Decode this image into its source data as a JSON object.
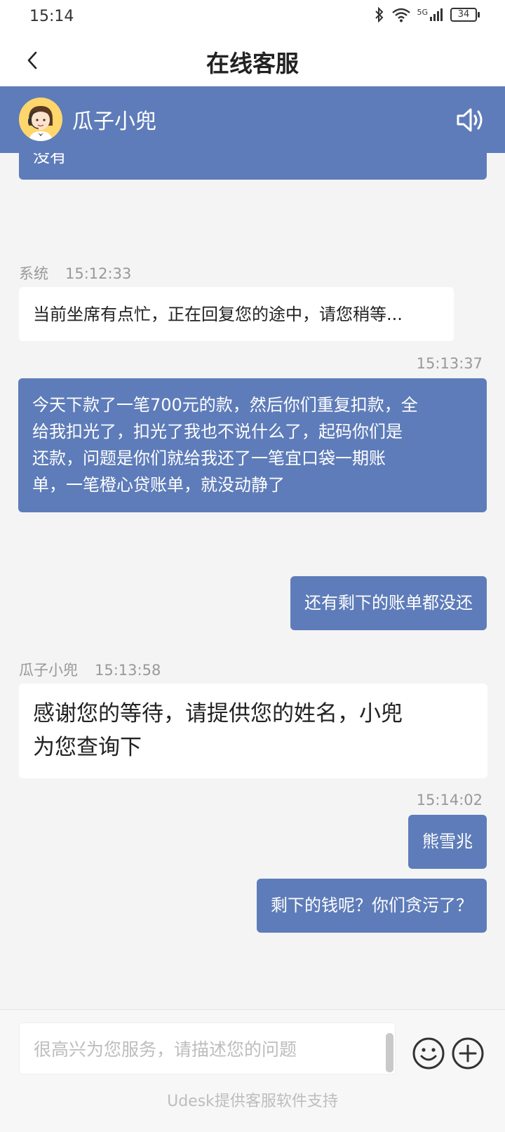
{
  "status_bar": {
    "time": "15:14",
    "signal": "5G",
    "battery": "34"
  },
  "header": {
    "title": "在线客服"
  },
  "agent": {
    "name": "瓜子小兜"
  },
  "messages": [
    {
      "type": "out",
      "text": "没有"
    },
    {
      "type": "in",
      "sender": "系统",
      "time": "15:12:33",
      "text": "当前坐席有点忙，正在回复您的途中，请您稍等..."
    },
    {
      "type": "out",
      "time": "15:13:37",
      "lines": [
        "今天下款了一笔700元的款，然后你们重复扣款，全",
        "给我扣光了，扣光了我也不说什么了，起码你们是",
        "还款，问题是你们就给我还了一笔宜口袋一期账",
        "单，一笔橙心贷账单，就没动静了"
      ]
    },
    {
      "type": "out",
      "text": "还有剩下的账单都没还"
    },
    {
      "type": "in",
      "sender": "瓜子小兜",
      "time": "15:13:58",
      "lines": [
        "感谢您的等待，请提供您的姓名，小兜",
        "为您查询下"
      ]
    },
    {
      "type": "out",
      "time": "15:14:02",
      "text": "熊雪兆"
    },
    {
      "type": "out",
      "text": "剩下的钱呢？你们贪污了？"
    }
  ],
  "input": {
    "placeholder": "很高兴为您服务，请描述您的问题"
  },
  "footer": {
    "text": "Udesk提供客服软件支持"
  },
  "colors": {
    "accent": "#5e7cb9",
    "background": "#f4f4f4"
  },
  "icons": [
    "back-icon",
    "speaker-icon",
    "emoji-icon",
    "add-icon",
    "bluetooth-icon",
    "wifi-icon",
    "signal-icon",
    "battery-icon"
  ]
}
